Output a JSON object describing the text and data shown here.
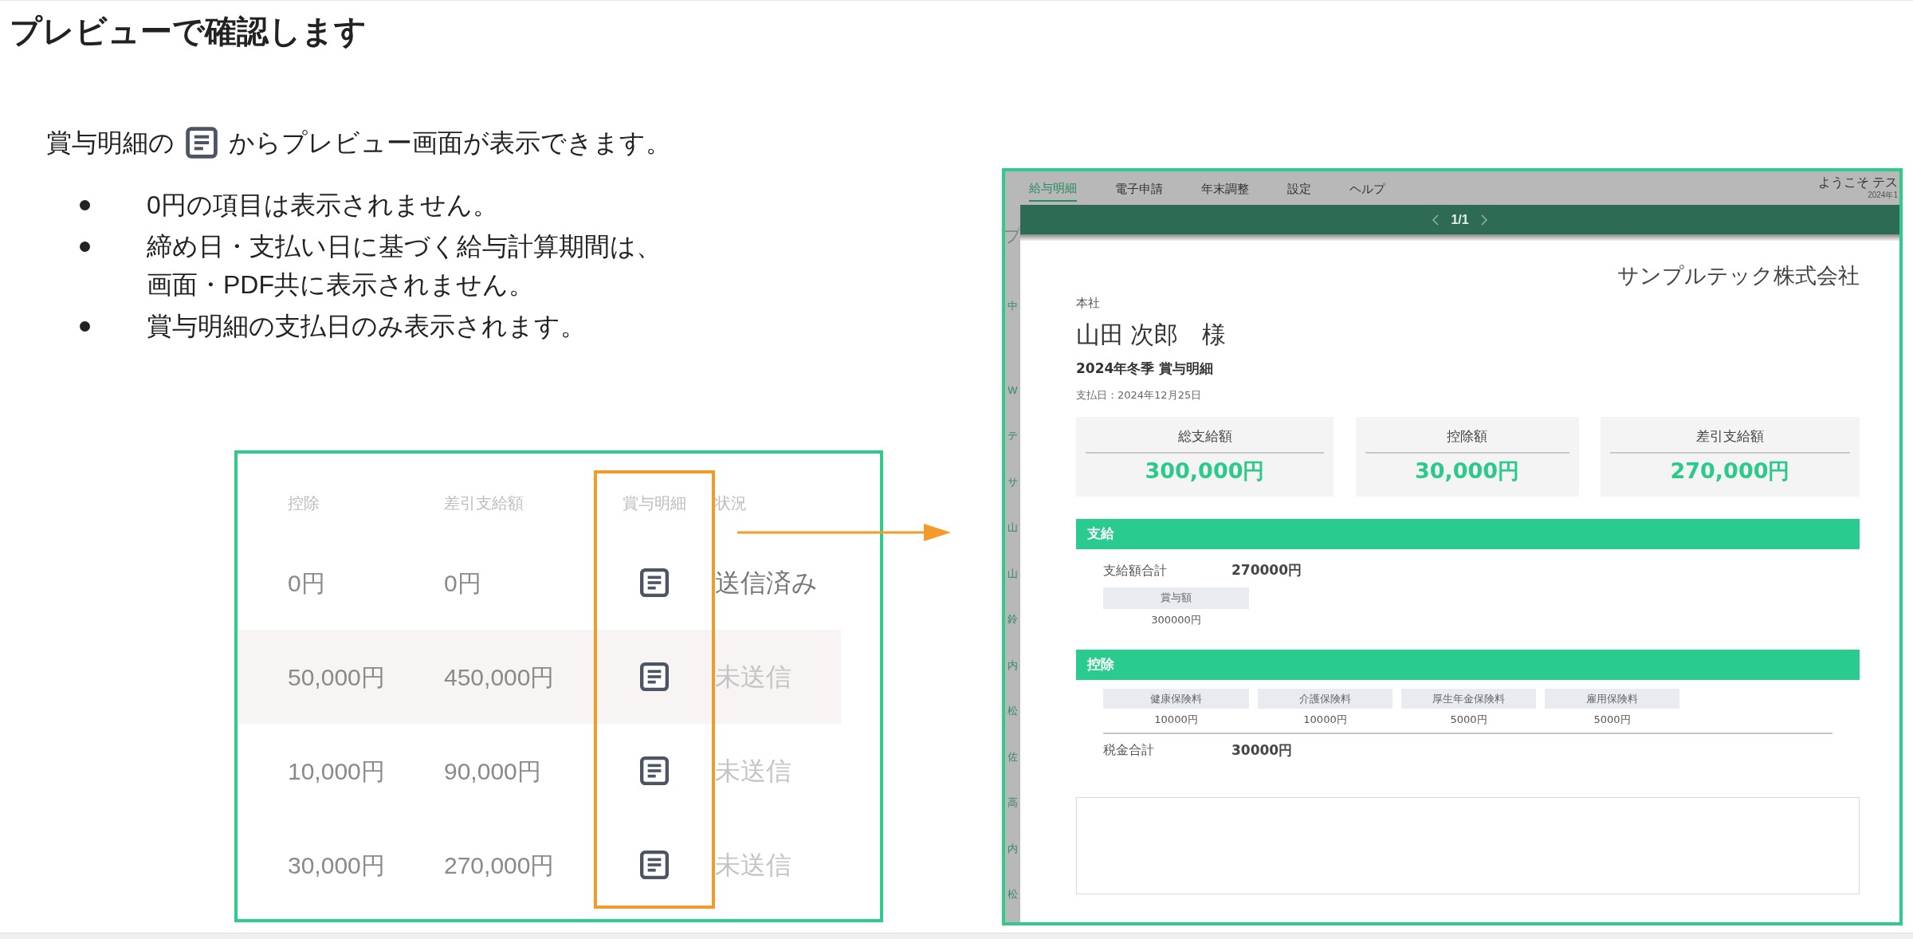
{
  "heading": "プレビューで確認します",
  "intro": {
    "before": "賞与明細の",
    "after": "からプレビュー画面が表示できます。"
  },
  "bullets": [
    "0円の項目は表示されません。",
    "締め日・支払い日に基づく給与計算期間は、画面・PDF共に表示されません。",
    "賞与明細の支払日のみ表示されます。"
  ],
  "list_screenshot": {
    "columns": [
      "控除",
      "差引支給額",
      "賞与明細",
      "状況"
    ],
    "rows": [
      {
        "deduction": "0円",
        "net": "0円",
        "status": "送信済み",
        "sent": true,
        "hovered": false
      },
      {
        "deduction": "50,000円",
        "net": "450,000円",
        "status": "未送信",
        "sent": false,
        "hovered": true
      },
      {
        "deduction": "10,000円",
        "net": "90,000円",
        "status": "未送信",
        "sent": false,
        "hovered": false
      },
      {
        "deduction": "30,000円",
        "net": "270,000円",
        "status": "未送信",
        "sent": false,
        "hovered": false
      }
    ]
  },
  "preview_screenshot": {
    "nav": [
      {
        "label": "給与明細",
        "selected": true
      },
      {
        "label": "電子申請",
        "selected": false
      },
      {
        "label": "年末調整",
        "selected": false
      },
      {
        "label": "設定",
        "selected": false
      },
      {
        "label": "ヘルプ",
        "selected": false
      }
    ],
    "welcome": "ようこそ テス",
    "date_fragment": "2024年1",
    "side_fragments": [
      "プ",
      "中",
      "W",
      "テ",
      "サ",
      "山",
      "山",
      "鈴",
      "内",
      "松",
      "佐",
      "高",
      "内",
      "松"
    ],
    "pager": "1/1",
    "company": "サンプルテック株式会社",
    "branch": "本社",
    "employee": "山田 次郎　様",
    "title": "2024年冬季 賞与明細",
    "pay_date": "支払日：2024年12月25日",
    "summary": [
      {
        "label": "総支給額",
        "value": "300,000円"
      },
      {
        "label": "控除額",
        "value": "30,000円"
      },
      {
        "label": "差引支給額",
        "value": "270,000円"
      }
    ],
    "payments": {
      "title": "支給",
      "total_label": "支給額合計",
      "total_value": "270000円",
      "items": [
        {
          "label": "賞与額",
          "value": "300000円"
        }
      ]
    },
    "deductions": {
      "title": "控除",
      "items": [
        {
          "label": "健康保険料",
          "value": "10000円"
        },
        {
          "label": "介護保険料",
          "value": "10000円"
        },
        {
          "label": "厚生年金保険料",
          "value": "5000円"
        },
        {
          "label": "雇用保険料",
          "value": "5000円"
        }
      ],
      "total_label": "税金合計",
      "total_value": "30000円"
    }
  }
}
